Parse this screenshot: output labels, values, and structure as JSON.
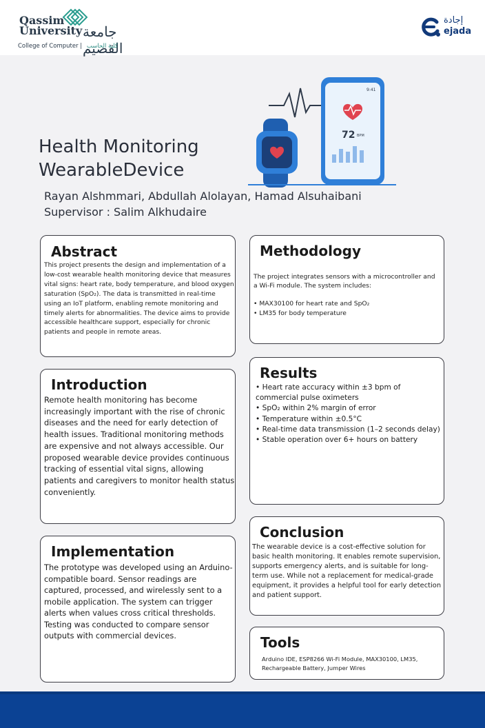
{
  "header": {
    "university_name_line1": "Qassim",
    "university_name_line2": "University",
    "university_name_ar": "جامعة القصيم",
    "college_en": "College of Computer",
    "college_separator": "|",
    "college_ar": "كلية الحاسب",
    "partner_name_ar": "إجادة",
    "partner_name_en": "ejada"
  },
  "hero": {
    "bpm_value": "72",
    "bpm_unit": "BPM",
    "time": "9:41"
  },
  "title": "Health Monitoring WearableDevice",
  "authors": "Rayan Alshmmari, Abdullah Alolayan, Hamad Alsuhaibani",
  "supervisor": "Supervisor : Salim Alkhudaire",
  "sections": {
    "abstract": {
      "heading": "Abstract",
      "body": "This project presents the design and implementation of a low-cost wearable health monitoring device that measures vital signs: heart rate, body temperature, and blood oxygen saturation (SpO₂). The data is transmitted in real-time using an IoT platform, enabling remote monitoring and timely alerts for abnormalities. The device aims to provide accessible healthcare support, especially for chronic patients and people in remote areas."
    },
    "methodology": {
      "heading": "Methodology",
      "body": "The project integrates sensors with a microcontroller and a Wi-Fi module. The system includes:",
      "items": [
        "MAX30100 for heart rate and SpO₂",
        "LM35 for body temperature"
      ]
    },
    "introduction": {
      "heading": "Introduction",
      "body": "Remote health monitoring has become increasingly important with the rise of chronic diseases and the need for early detection of health issues. Traditional monitoring methods are expensive and not always accessible. Our proposed wearable device provides continuous tracking of essential vital signs, allowing patients and caregivers to monitor health status conveniently."
    },
    "results": {
      "heading": "Results",
      "items": [
        "Heart rate accuracy within ±3 bpm of commercial pulse oximeters",
        "SpO₂ within 2% margin of error",
        "Temperature within ±0.5°C",
        "Real-time data transmission (1–2 seconds delay)",
        "Stable operation over 6+ hours on battery"
      ]
    },
    "implementation": {
      "heading": "Implementation",
      "body": "The prototype was developed using an Arduino-compatible board. Sensor readings are captured, processed, and wirelessly sent to a mobile application. The system can trigger alerts when values cross critical thresholds. Testing was conducted to compare sensor outputs with commercial devices."
    },
    "conclusion": {
      "heading": "Conclusion",
      "body": "The wearable device is a cost-effective solution for basic health monitoring. It enables remote supervision, supports emergency alerts, and is suitable for long-term use. While not a replacement for medical-grade equipment, it provides a helpful tool for early detection and patient support."
    },
    "tools": {
      "heading": "Tools",
      "body": "Arduino IDE, ESP8266 Wi-Fi Module, MAX30100, LM35, Rechargeable Battery, Jumper Wires"
    }
  },
  "colors": {
    "accent_blue": "#2f7fd8",
    "heart_red": "#e0434f",
    "footer_blue": "#0b4294",
    "teal": "#2a9d8f"
  },
  "icons": [
    "university-pattern-icon",
    "ejada-logo-icon",
    "smartwatch-icon",
    "smartphone-icon",
    "heart-icon",
    "pulse-wave-icon"
  ]
}
